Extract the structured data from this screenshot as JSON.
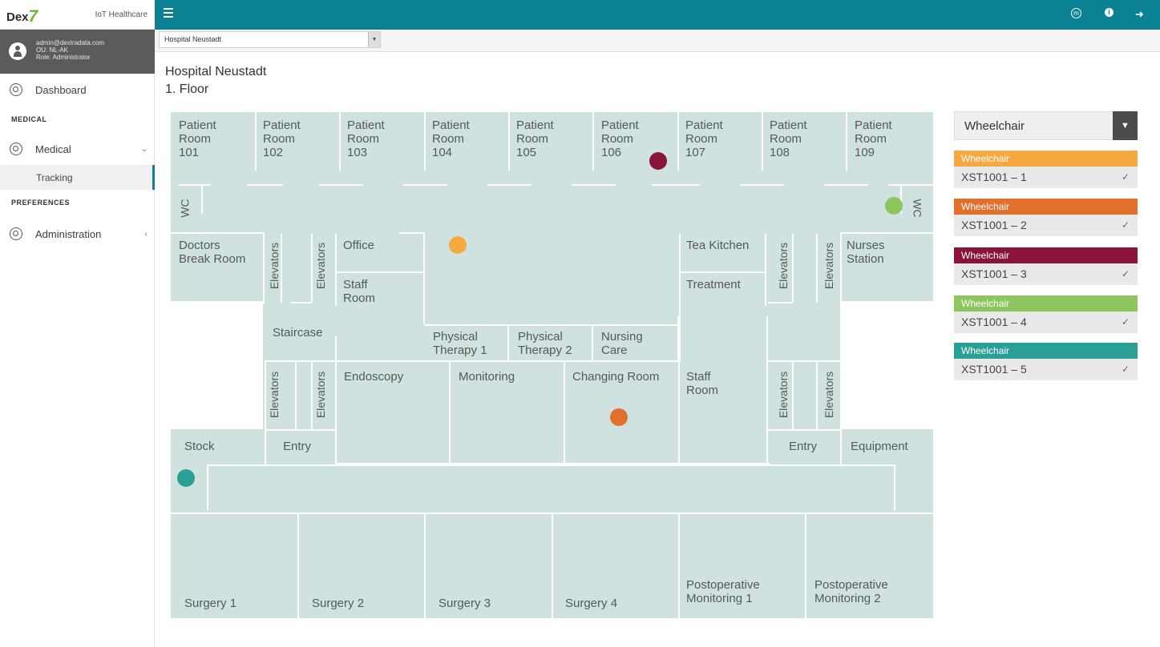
{
  "brand": {
    "logo": "Dex",
    "logo_mark": "7",
    "product": "IoT Healthcare"
  },
  "topbar": {
    "icons": [
      "menu-icon",
      "medical-info-icon",
      "info-icon",
      "logout-icon"
    ],
    "color": "#0b8294"
  },
  "user": {
    "email": "admin@dextradata.com",
    "ou": "OU: NL-AK",
    "role": "Role: Administrator"
  },
  "sidebar": {
    "dashboard": "Dashboard",
    "section_medical": "MEDICAL",
    "medical": "Medical",
    "tracking": "Tracking",
    "section_preferences": "PREFERENCES",
    "administration": "Administration"
  },
  "hospital_select": {
    "value": "Hospital Neustadt"
  },
  "page": {
    "title": "Hospital Neustadt",
    "subtitle": "1. Floor"
  },
  "floorplan": {
    "rooms": [
      {
        "id": "101",
        "label": "Patient\nRoom\n101"
      },
      {
        "id": "102",
        "label": "Patient\nRoom\n102"
      },
      {
        "id": "103",
        "label": "Patient\nRoom\n103"
      },
      {
        "id": "104",
        "label": "Patient\nRoom\n104"
      },
      {
        "id": "105",
        "label": "Patient\nRoom\n105"
      },
      {
        "id": "106",
        "label": "Patient\nRoom\n106"
      },
      {
        "id": "107",
        "label": "Patient\nRoom\n107"
      },
      {
        "id": "108",
        "label": "Patient\nRoom\n108"
      },
      {
        "id": "109",
        "label": "Patient\nRoom\n109"
      }
    ],
    "wc": "WC",
    "doctors_break_room": "Doctors\nBreak Room",
    "elevators": "Elevators",
    "office": "Office",
    "staff_room": "Staff\nRoom",
    "staircase": "Staircase",
    "physical_therapy_1": "Physical\nTherapy 1",
    "physical_therapy_2": "Physical\nTherapy 2",
    "nursing_care": "Nursing\nCare",
    "tea_kitchen": "Tea Kitchen",
    "treatment": "Treatment",
    "nurses_station": "Nurses\nStation",
    "endoscopy": "Endoscopy",
    "monitoring": "Monitoring",
    "changing_room": "Changing Room",
    "staff_room_2": "Staff\nRoom",
    "stock": "Stock",
    "entry": "Entry",
    "equipment": "Equipment",
    "surgery_1": "Surgery 1",
    "surgery_2": "Surgery 2",
    "surgery_3": "Surgery 3",
    "surgery_4": "Surgery 4",
    "postop_1": "Postoperative\nMonitoring 1",
    "postop_2": "Postoperative\nMonitoring 2"
  },
  "asset_filter": {
    "value": "Wheelchair"
  },
  "assets": [
    {
      "type": "Wheelchair",
      "id": "XST1001 – 1",
      "color": "#f7a941"
    },
    {
      "type": "Wheelchair",
      "id": "XST1001 – 2",
      "color": "#e0702a"
    },
    {
      "type": "Wheelchair",
      "id": "XST1001 – 3",
      "color": "#8a1438"
    },
    {
      "type": "Wheelchair",
      "id": "XST1001 – 4",
      "color": "#8cc65d"
    },
    {
      "type": "Wheelchair",
      "id": "XST1001 – 5",
      "color": "#2a9f95"
    }
  ]
}
